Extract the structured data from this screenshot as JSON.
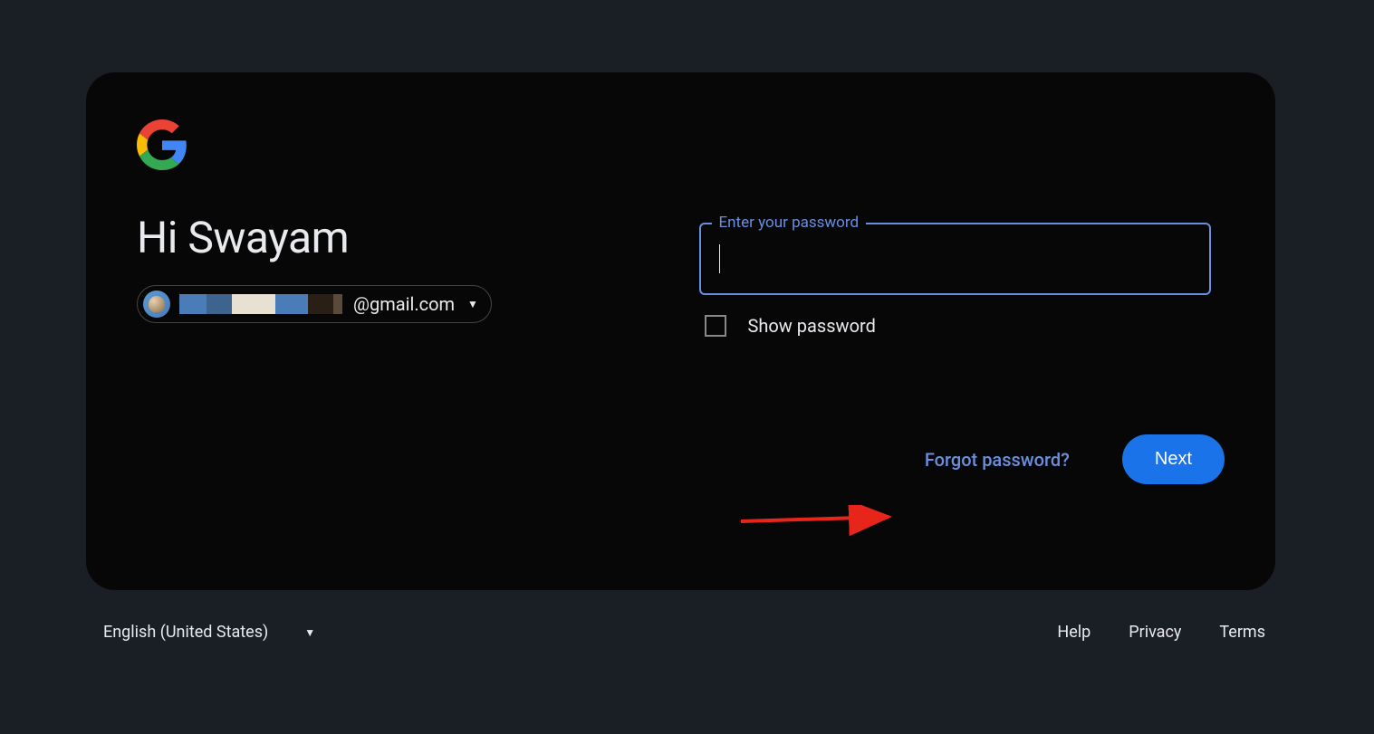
{
  "greeting": "Hi Swayam",
  "account": {
    "email_domain": "@gmail.com"
  },
  "password": {
    "label": "Enter your password",
    "value": "",
    "show_label": "Show password"
  },
  "actions": {
    "forgot": "Forgot password?",
    "next": "Next"
  },
  "footer": {
    "language": "English (United States)",
    "links": {
      "help": "Help",
      "privacy": "Privacy",
      "terms": "Terms"
    }
  }
}
